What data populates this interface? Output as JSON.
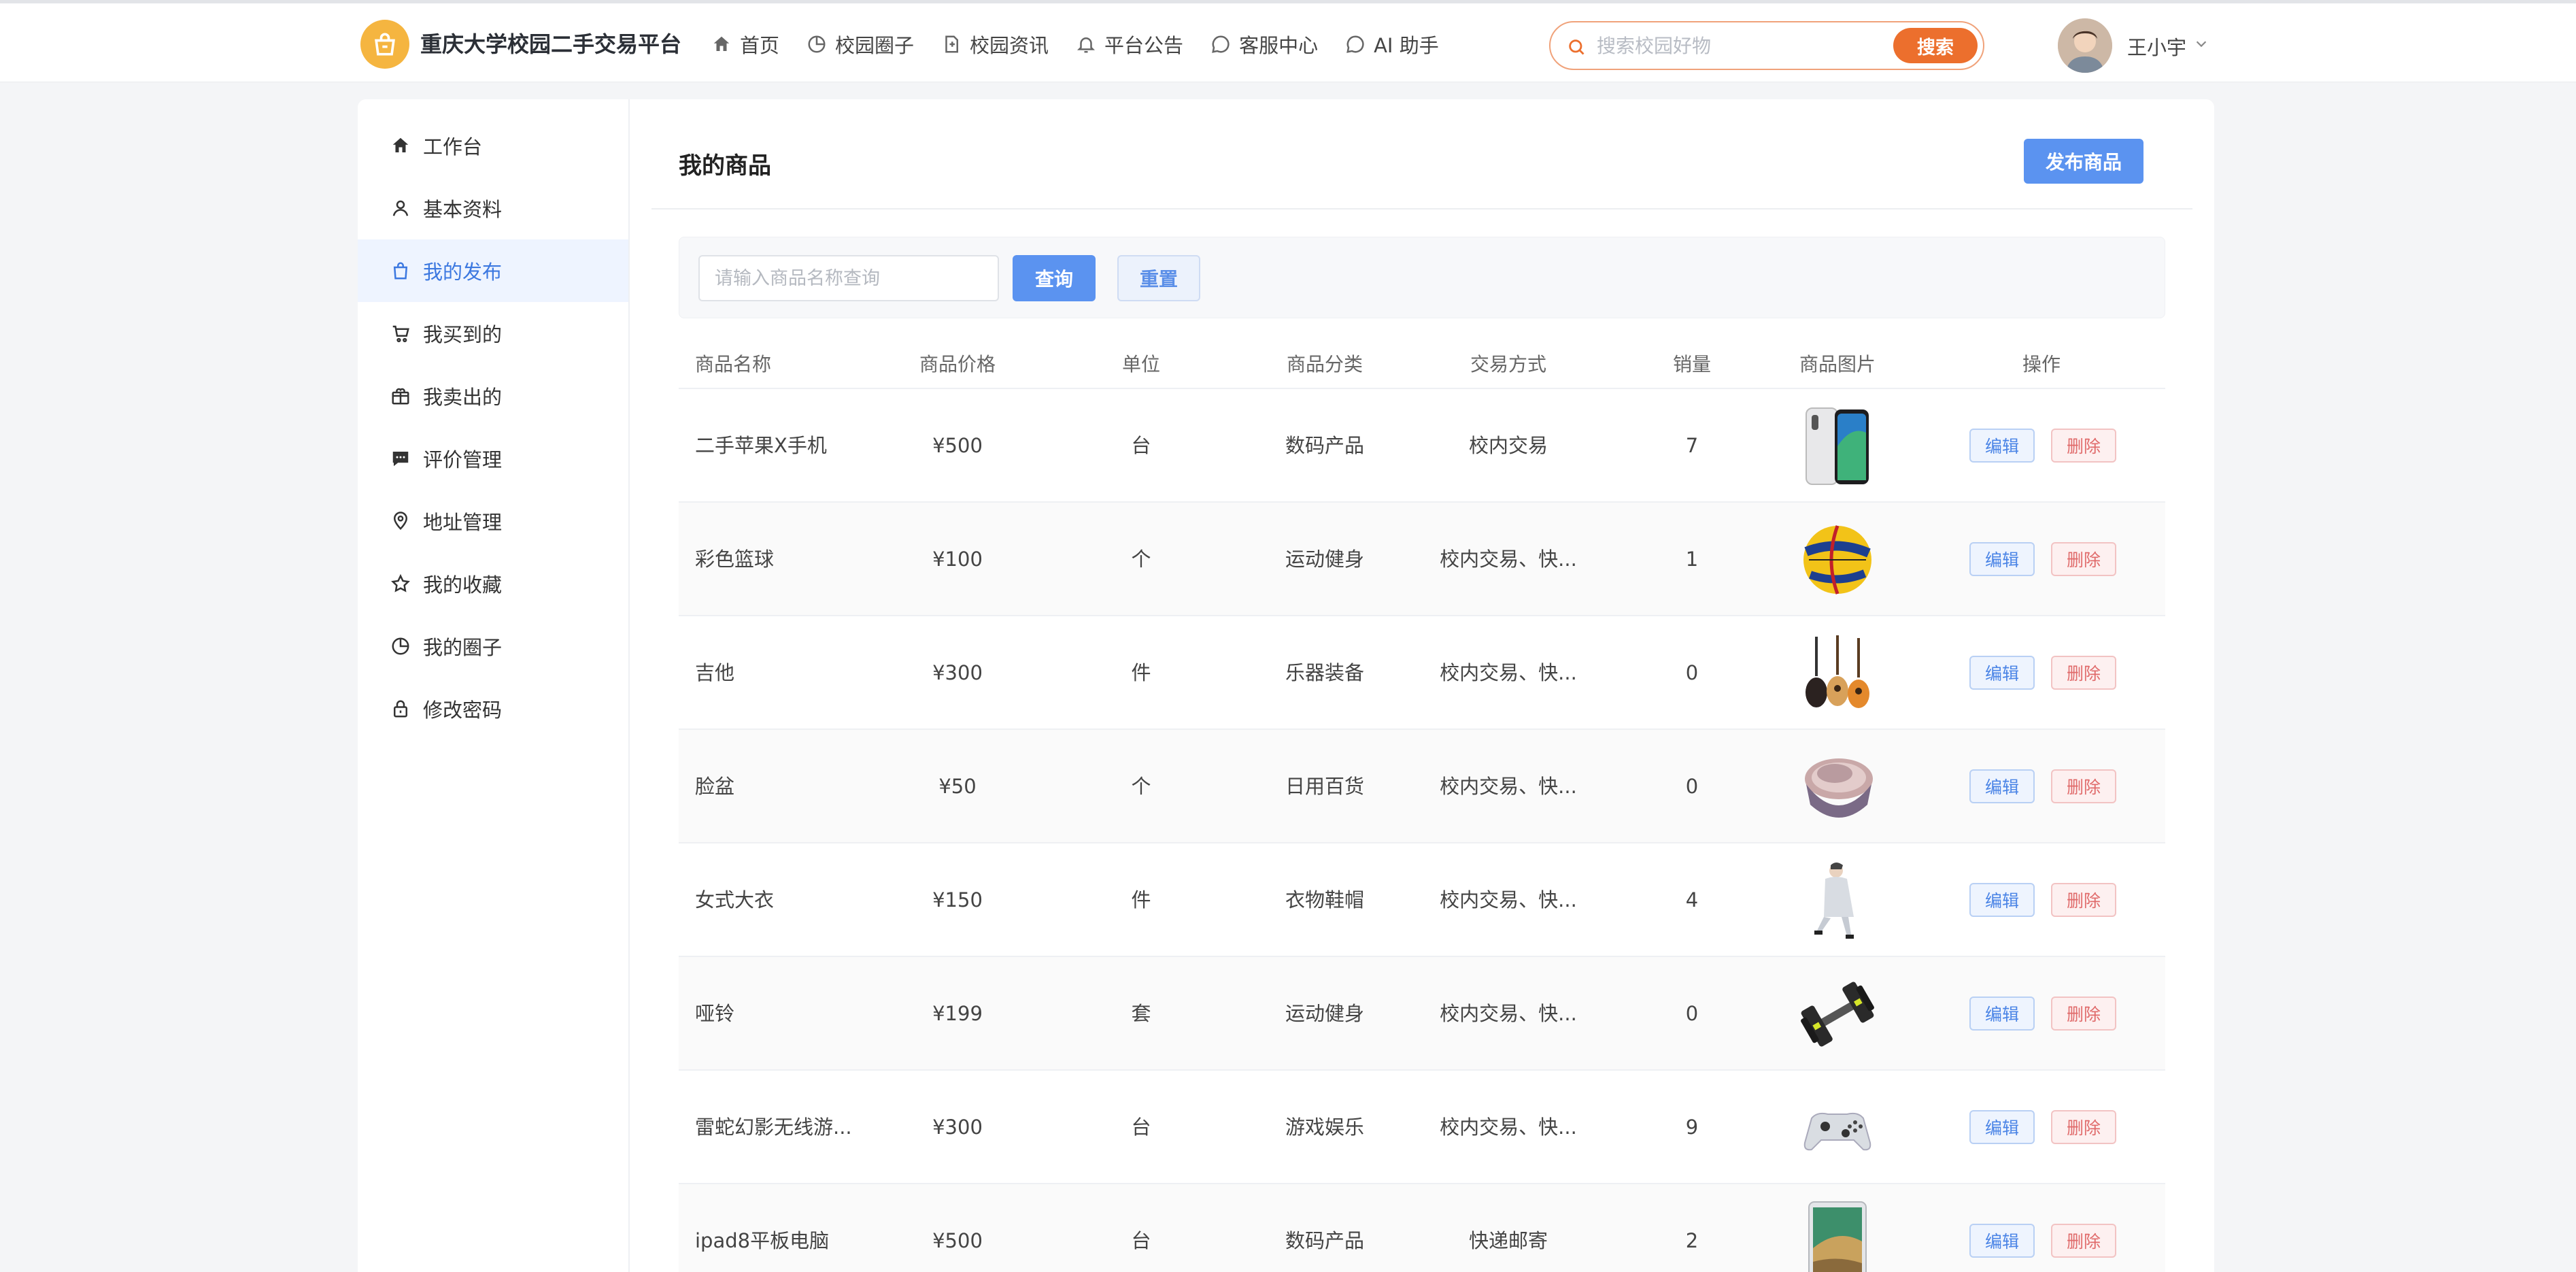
{
  "header": {
    "brand": "重庆大学校园二手交易平台",
    "nav": [
      {
        "label": "首页",
        "icon": "home-icon"
      },
      {
        "label": "校园圈子",
        "icon": "pie-chart-icon"
      },
      {
        "label": "校园资讯",
        "icon": "document-icon"
      },
      {
        "label": "平台公告",
        "icon": "bell-icon"
      },
      {
        "label": "客服中心",
        "icon": "chat-bubble-icon"
      },
      {
        "label": "AI 助手",
        "icon": "chat-bubble-icon"
      }
    ],
    "search_placeholder": "搜索校园好物",
    "search_button": "搜索",
    "user_name": "王小宇",
    "accent_color": "#ec6f2d"
  },
  "sidebar": {
    "items": [
      {
        "label": "工作台",
        "icon": "home-icon"
      },
      {
        "label": "基本资料",
        "icon": "user-icon"
      },
      {
        "label": "我的发布",
        "icon": "shopping-bag-icon",
        "active": true
      },
      {
        "label": "我买到的",
        "icon": "cart-icon"
      },
      {
        "label": "我卖出的",
        "icon": "gift-box-icon"
      },
      {
        "label": "评价管理",
        "icon": "comment-icon"
      },
      {
        "label": "地址管理",
        "icon": "location-pin-icon"
      },
      {
        "label": "我的收藏",
        "icon": "star-icon"
      },
      {
        "label": "我的圈子",
        "icon": "pie-chart-icon"
      },
      {
        "label": "修改密码",
        "icon": "lock-icon"
      }
    ]
  },
  "main": {
    "title": "我的商品",
    "publish_button": "发布商品",
    "filter": {
      "placeholder": "请输入商品名称查询",
      "query_button": "查询",
      "reset_button": "重置"
    },
    "table": {
      "columns": [
        "商品名称",
        "商品价格",
        "单位",
        "商品分类",
        "交易方式",
        "销量",
        "商品图片",
        "操作"
      ],
      "rows": [
        {
          "name": "二手苹果X手机",
          "price": "¥500",
          "unit": "台",
          "category": "数码产品",
          "trade": "校内交易",
          "sales": "7",
          "image": "iphone-image"
        },
        {
          "name": "彩色篮球",
          "price": "¥100",
          "unit": "个",
          "category": "运动健身",
          "trade": "校内交易、快...",
          "sales": "1",
          "image": "basketball-image"
        },
        {
          "name": "吉他",
          "price": "¥300",
          "unit": "件",
          "category": "乐器装备",
          "trade": "校内交易、快...",
          "sales": "0",
          "image": "guitar-image"
        },
        {
          "name": "脸盆",
          "price": "¥50",
          "unit": "个",
          "category": "日用百货",
          "trade": "校内交易、快...",
          "sales": "0",
          "image": "basin-image"
        },
        {
          "name": "女式大衣",
          "price": "¥150",
          "unit": "件",
          "category": "衣物鞋帽",
          "trade": "校内交易、快...",
          "sales": "4",
          "image": "coat-image"
        },
        {
          "name": "哑铃",
          "price": "¥199",
          "unit": "套",
          "category": "运动健身",
          "trade": "校内交易、快...",
          "sales": "0",
          "image": "dumbbell-image"
        },
        {
          "name": "雷蛇幻影无线游...",
          "price": "¥300",
          "unit": "台",
          "category": "游戏娱乐",
          "trade": "校内交易、快...",
          "sales": "9",
          "image": "gamepad-image"
        },
        {
          "name": "ipad8平板电脑",
          "price": "¥500",
          "unit": "台",
          "category": "数码产品",
          "trade": "快递邮寄",
          "sales": "2",
          "image": "ipad-image"
        }
      ],
      "edit_label": "编辑",
      "delete_label": "删除"
    }
  }
}
